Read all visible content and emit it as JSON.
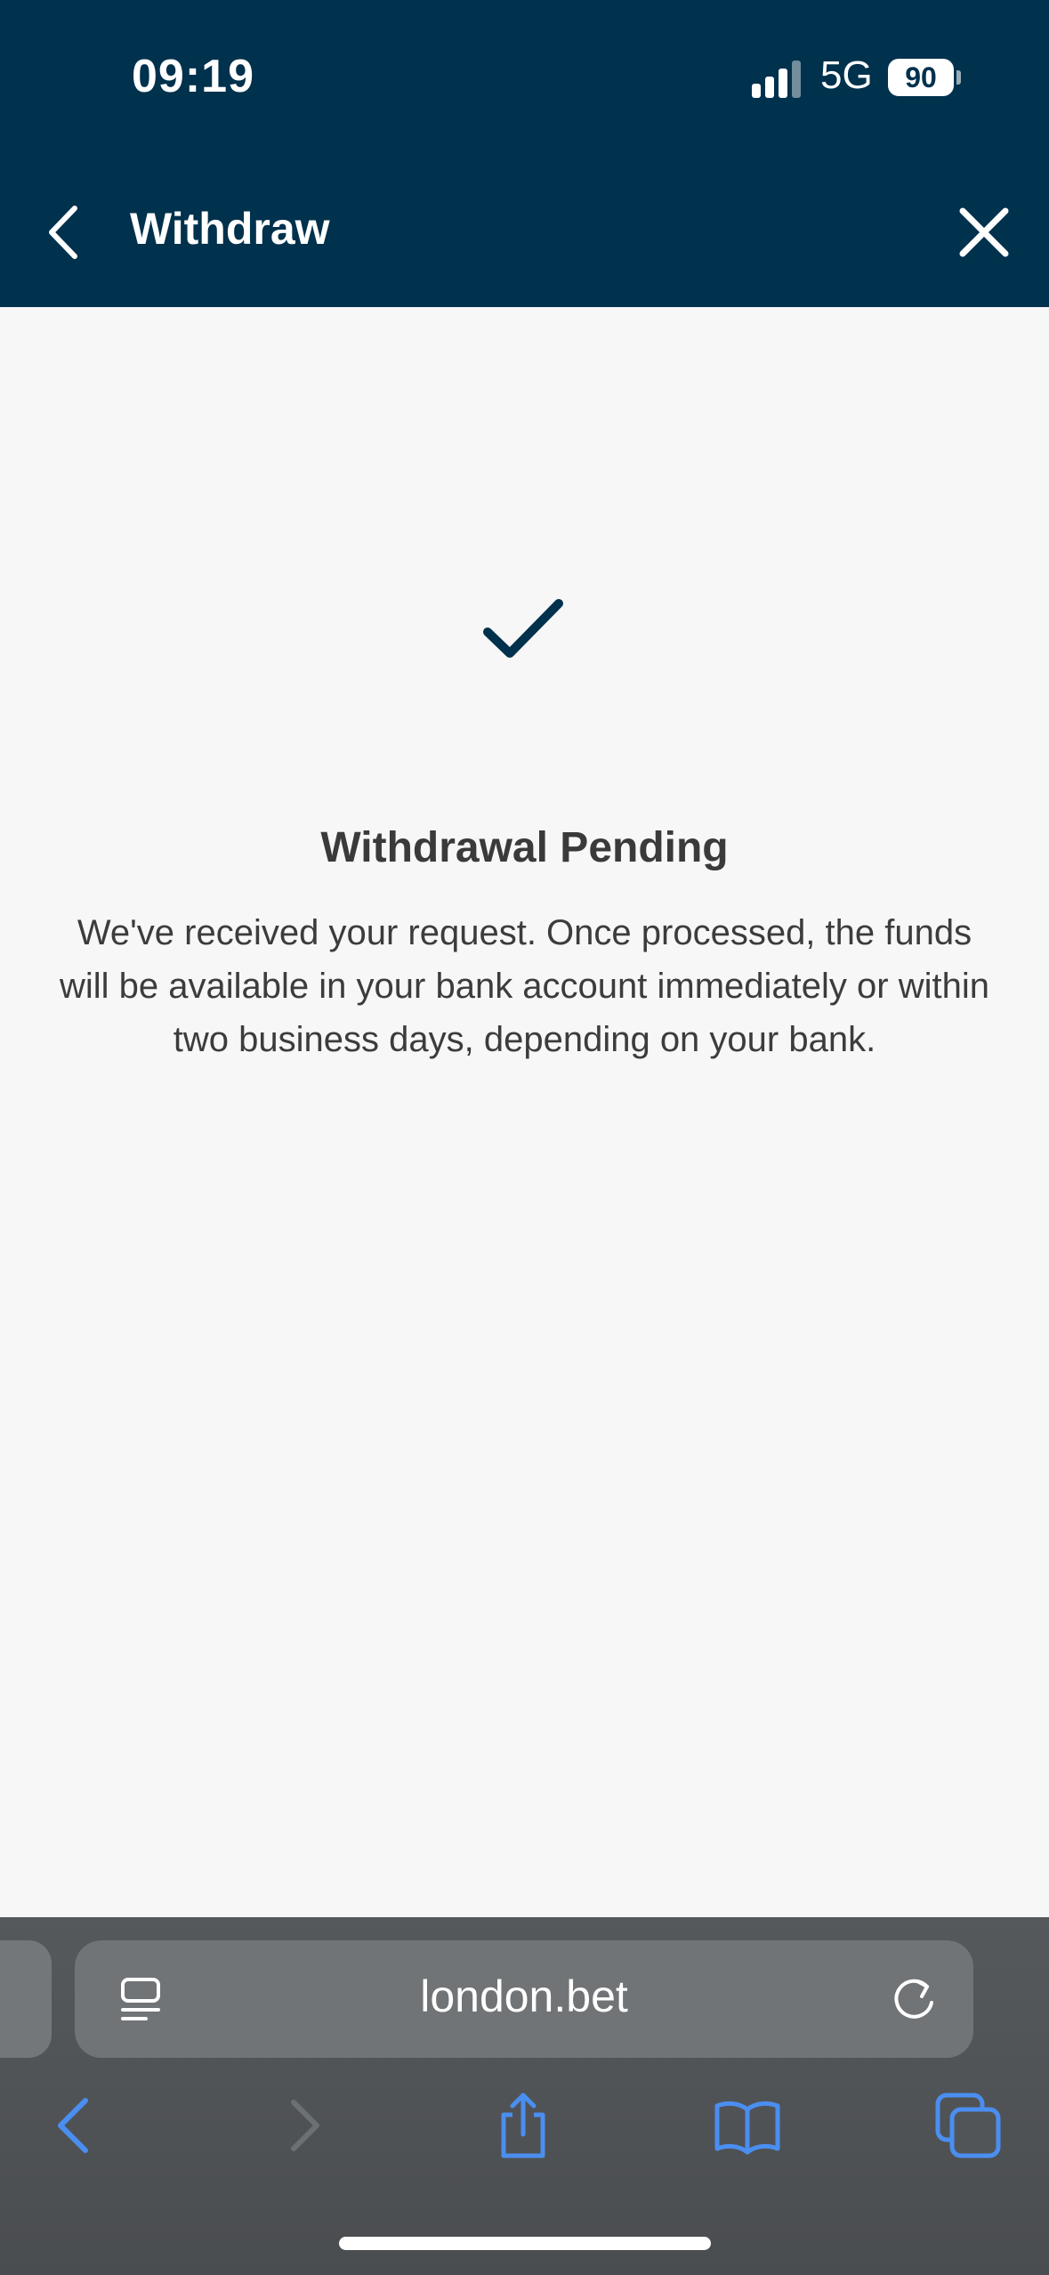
{
  "status_bar": {
    "time": "09:19",
    "network": "5G",
    "battery": "90",
    "signal_icon": "signal-bars-icon"
  },
  "header": {
    "title": "Withdraw",
    "back_icon": "chevron-left-icon",
    "close_icon": "close-icon",
    "background": "#00314d"
  },
  "content": {
    "status_icon": "checkmark-icon",
    "title": "Withdrawal Pending",
    "message": "We've received your request. Once processed, the funds will be available in your bank account immediately or within two business days, depending on your bank."
  },
  "browser": {
    "url": "london.bet",
    "icons": [
      "tab-overview-icon",
      "reload-icon",
      "back-icon",
      "forward-icon",
      "share-icon",
      "bookmarks-icon",
      "tabs-icon"
    ],
    "accent": "#4a8ef0"
  }
}
